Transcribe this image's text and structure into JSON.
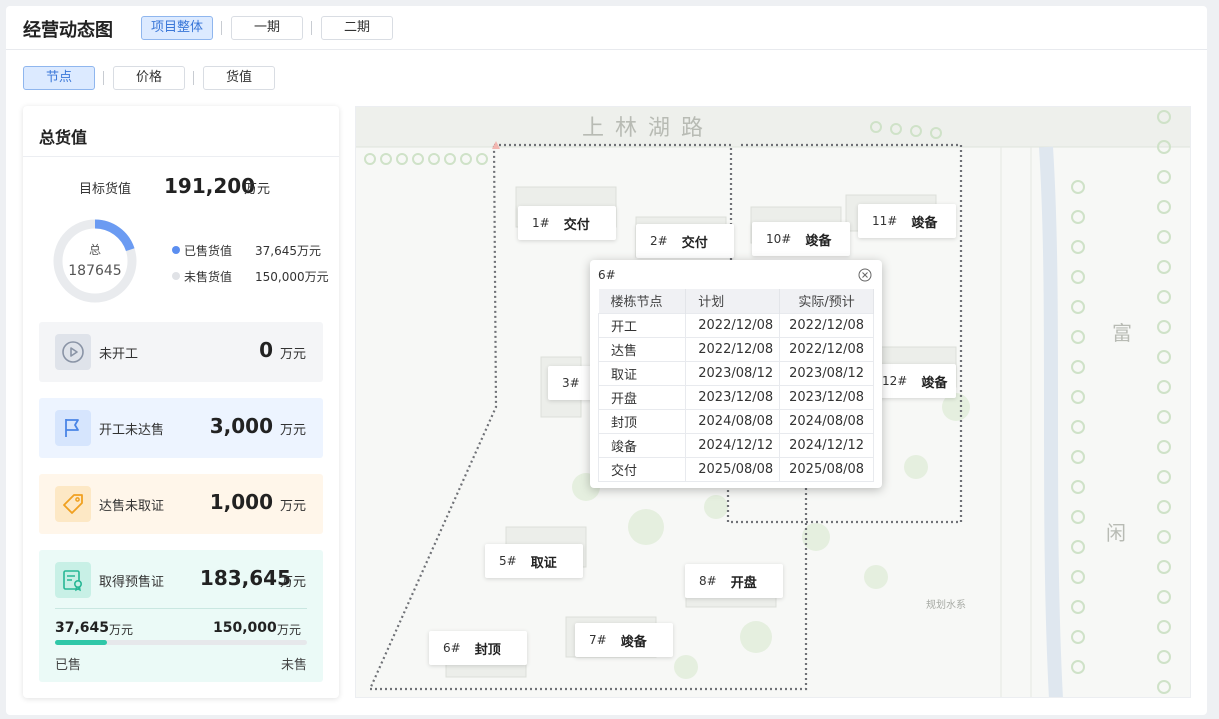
{
  "header": {
    "title": "经营动态图",
    "tabs": [
      {
        "label": "项目整体",
        "active": true
      },
      {
        "label": "一期",
        "active": false
      },
      {
        "label": "二期",
        "active": false
      }
    ]
  },
  "subtabs": [
    {
      "label": "节点",
      "active": true
    },
    {
      "label": "价格",
      "active": false
    },
    {
      "label": "货值",
      "active": false
    }
  ],
  "summary": {
    "title": "总货值",
    "target_label": "目标货值",
    "target_value": "191,200",
    "target_unit": "万元",
    "donut": {
      "center_label": "总",
      "center_value": "187645",
      "sold_fraction": 0.2,
      "sold_color": "#6b9bf2",
      "unsold_color": "#e9ebee"
    },
    "legend": [
      {
        "label": "已售货值",
        "value": "37,645万元",
        "color": "#5b8ef0"
      },
      {
        "label": "未售货值",
        "value": "150,000万元",
        "color": "#e0e2e6"
      }
    ],
    "stats": [
      {
        "label": "未开工",
        "value": "0",
        "unit": "万元",
        "icon": "play-circle-icon"
      },
      {
        "label": "开工未达售",
        "value": "3,000",
        "unit": "万元",
        "icon": "flag-icon"
      },
      {
        "label": "达售未取证",
        "value": "1,000",
        "unit": "万元",
        "icon": "tag-icon"
      }
    ],
    "presale": {
      "label": "取得预售证",
      "value": "183,645",
      "unit": "万元",
      "icon": "certificate-icon",
      "sold_value": "37,645",
      "sold_unit": "万元",
      "unsold_value": "150,000",
      "unsold_unit": "万元",
      "sold_caption": "已售",
      "unsold_caption": "未售",
      "sold_fraction": 0.205
    }
  },
  "map": {
    "road_label": "上 林 湖 路",
    "side_labels": [
      "富",
      "闲"
    ],
    "water_label": "规划水系",
    "buildings": [
      {
        "no": "1#",
        "status": "交付"
      },
      {
        "no": "2#",
        "status": "交付"
      },
      {
        "no": "3#",
        "status": ""
      },
      {
        "no": "5#",
        "status": "取证"
      },
      {
        "no": "6#",
        "status": "封顶"
      },
      {
        "no": "7#",
        "status": "竣备"
      },
      {
        "no": "8#",
        "status": "开盘"
      },
      {
        "no": "10#",
        "status": "竣备"
      },
      {
        "no": "11#",
        "status": "竣备"
      },
      {
        "no": "12#",
        "status": "竣备"
      }
    ],
    "popup": {
      "title": "6#",
      "headers": [
        "楼栋节点",
        "计划",
        "实际/预计"
      ],
      "rows": [
        [
          "开工",
          "2022/12/08",
          "2022/12/08"
        ],
        [
          "达售",
          "2022/12/08",
          "2022/12/08"
        ],
        [
          "取证",
          "2023/08/12",
          "2023/08/12"
        ],
        [
          "开盘",
          "2023/12/08",
          "2023/12/08"
        ],
        [
          "封顶",
          "2024/08/08",
          "2024/08/08"
        ],
        [
          "竣备",
          "2024/12/12",
          "2024/12/12"
        ],
        [
          "交付",
          "2025/08/08",
          "2025/08/08"
        ]
      ]
    }
  }
}
